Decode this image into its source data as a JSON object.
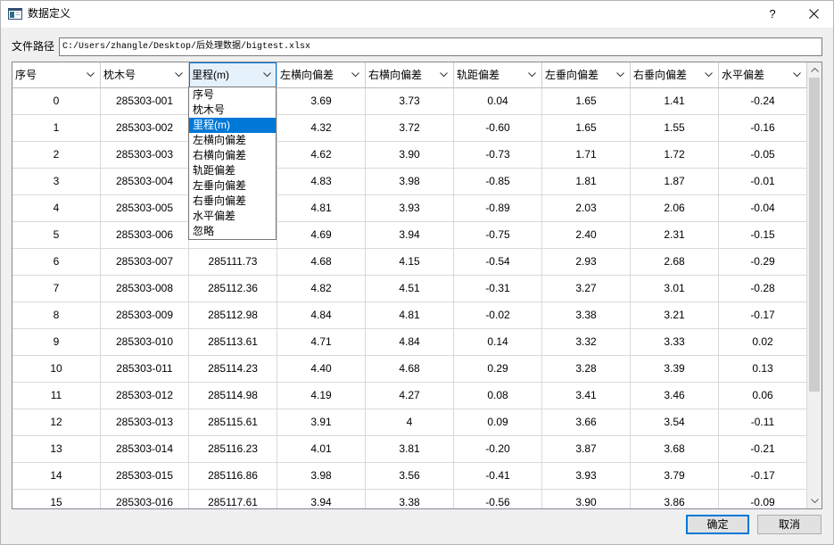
{
  "window": {
    "title": "数据定义",
    "help_label": "?"
  },
  "icons": {
    "app": "window-icon",
    "close": "close-icon",
    "header_dropdown": "chevron-down-icon",
    "scroll_up": "chevron-up-icon",
    "scroll_down": "chevron-down-icon"
  },
  "file_path": {
    "label": "文件路径",
    "value": "C:/Users/zhangle/Desktop/后处理数据/bigtest.xlsx"
  },
  "table": {
    "columns": [
      {
        "label": "序号"
      },
      {
        "label": "枕木号"
      },
      {
        "label": "里程(m)"
      },
      {
        "label": "左横向偏差"
      },
      {
        "label": "右横向偏差"
      },
      {
        "label": "轨距偏差"
      },
      {
        "label": "左垂向偏差"
      },
      {
        "label": "右垂向偏差"
      },
      {
        "label": "水平偏差"
      }
    ],
    "active_column": 2,
    "rows": [
      [
        "0",
        "285303-001",
        null,
        "3.69",
        "3.73",
        "0.04",
        "1.65",
        "1.41",
        "-0.24"
      ],
      [
        "1",
        "285303-002",
        null,
        "4.32",
        "3.72",
        "-0.60",
        "1.65",
        "1.55",
        "-0.16"
      ],
      [
        "2",
        "285303-003",
        null,
        "4.62",
        "3.90",
        "-0.73",
        "1.71",
        "1.72",
        "-0.05"
      ],
      [
        "3",
        "285303-004",
        null,
        "4.83",
        "3.98",
        "-0.85",
        "1.81",
        "1.87",
        "-0.01"
      ],
      [
        "4",
        "285303-005",
        null,
        "4.81",
        "3.93",
        "-0.89",
        "2.03",
        "2.06",
        "-0.04"
      ],
      [
        "5",
        "285303-006",
        null,
        "4.69",
        "3.94",
        "-0.75",
        "2.40",
        "2.31",
        "-0.15"
      ],
      [
        "6",
        "285303-007",
        "285111.73",
        "4.68",
        "4.15",
        "-0.54",
        "2.93",
        "2.68",
        "-0.29"
      ],
      [
        "7",
        "285303-008",
        "285112.36",
        "4.82",
        "4.51",
        "-0.31",
        "3.27",
        "3.01",
        "-0.28"
      ],
      [
        "8",
        "285303-009",
        "285112.98",
        "4.84",
        "4.81",
        "-0.02",
        "3.38",
        "3.21",
        "-0.17"
      ],
      [
        "9",
        "285303-010",
        "285113.61",
        "4.71",
        "4.84",
        "0.14",
        "3.32",
        "3.33",
        "0.02"
      ],
      [
        "10",
        "285303-011",
        "285114.23",
        "4.40",
        "4.68",
        "0.29",
        "3.28",
        "3.39",
        "0.13"
      ],
      [
        "11",
        "285303-012",
        "285114.98",
        "4.19",
        "4.27",
        "0.08",
        "3.41",
        "3.46",
        "0.06"
      ],
      [
        "12",
        "285303-013",
        "285115.61",
        "3.91",
        "4",
        "0.09",
        "3.66",
        "3.54",
        "-0.11"
      ],
      [
        "13",
        "285303-014",
        "285116.23",
        "4.01",
        "3.81",
        "-0.20",
        "3.87",
        "3.68",
        "-0.21"
      ],
      [
        "14",
        "285303-015",
        "285116.86",
        "3.98",
        "3.56",
        "-0.41",
        "3.93",
        "3.79",
        "-0.17"
      ],
      [
        "15",
        "285303-016",
        "285117.61",
        "3.94",
        "3.38",
        "-0.56",
        "3.90",
        "3.86",
        "-0.09"
      ]
    ]
  },
  "column_dropdown": {
    "open": true,
    "items": [
      "序号",
      "枕木号",
      "里程(m)",
      "左横向偏差",
      "右横向偏差",
      "轨距偏差",
      "左垂向偏差",
      "右垂向偏差",
      "水平偏差",
      "忽略"
    ],
    "selected_index": 2
  },
  "scrollbar": {
    "position": 0,
    "visible_fraction": 0.755
  },
  "buttons": {
    "ok_label": "确定",
    "cancel_label": "取消"
  },
  "colors": {
    "accent": "#0078d7",
    "active_header_bg": "#e5f1fb",
    "window_bg": "#f0f0f0"
  }
}
